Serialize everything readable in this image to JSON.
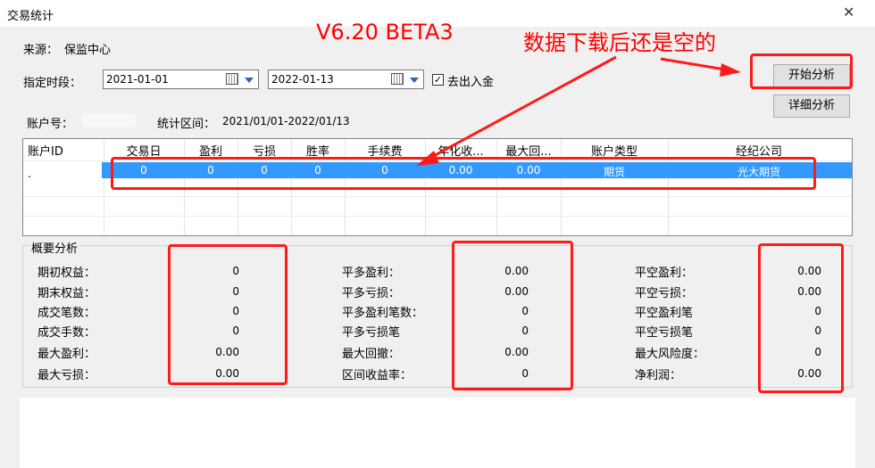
{
  "window": {
    "title": "交易统计",
    "close_glyph": "✕"
  },
  "source": {
    "label": "来源：",
    "value": "保监中心"
  },
  "period": {
    "label": "指定时段：",
    "start_date": "2021-01-01",
    "end_date": "2022-01-13"
  },
  "exclude_io": {
    "label": "去出入金",
    "checked": true
  },
  "buttons": {
    "start_analysis": "开始分析",
    "detail_analysis": "详细分析"
  },
  "account": {
    "label": "账户号：",
    "range_label": "统计区间：",
    "range_value": "2021/01/01-2022/01/13"
  },
  "grid": {
    "columns": [
      "账户ID",
      "交易日",
      "盈利",
      "亏损",
      "胜率",
      "手续费",
      "年化收...",
      "最大回...",
      "账户类型",
      "经纪公司"
    ],
    "rows": [
      {
        "account_id": ".",
        "trading_days": "0",
        "profit": "0",
        "loss": "0",
        "win_rate": "0",
        "fee": "0",
        "annual": "0.00",
        "max_drawdown": "0.00",
        "account_type": "期货",
        "broker": "光大期货"
      }
    ]
  },
  "summary": {
    "legend": "概要分析",
    "col1": [
      {
        "label": "期初权益：",
        "value": "0"
      },
      {
        "label": "期末权益：",
        "value": "0"
      },
      {
        "label": "成交笔数：",
        "value": "0"
      },
      {
        "label": "成交手数：",
        "value": "0"
      },
      {
        "label": "最大盈利：",
        "value": "0.00"
      },
      {
        "label": "最大亏损：",
        "value": "0.00"
      }
    ],
    "col2": [
      {
        "label": "平多盈利：",
        "value": "0.00"
      },
      {
        "label": "平多亏损：",
        "value": "0.00"
      },
      {
        "label": "平多盈利笔数：",
        "value": "0"
      },
      {
        "label": "平多亏损笔",
        "value": "0"
      },
      {
        "label": "最大回撤：",
        "value": "0.00"
      },
      {
        "label": "区间收益率：",
        "value": "0"
      }
    ],
    "col3": [
      {
        "label": "平空盈利：",
        "value": "0.00"
      },
      {
        "label": "平空亏损：",
        "value": "0.00"
      },
      {
        "label": "平空盈利笔",
        "value": "0"
      },
      {
        "label": "平空亏损笔",
        "value": "0"
      },
      {
        "label": "最大风险度：",
        "value": "0"
      },
      {
        "label": "净利润：",
        "value": "0.00"
      }
    ]
  },
  "annotations": {
    "version": "V6.20 BETA3",
    "note": "数据下载后还是空的",
    "color": "#ff0000"
  },
  "icons": {
    "calendar": "calendar-icon",
    "dropdown": "chevron-down-icon",
    "close": "close-icon"
  }
}
